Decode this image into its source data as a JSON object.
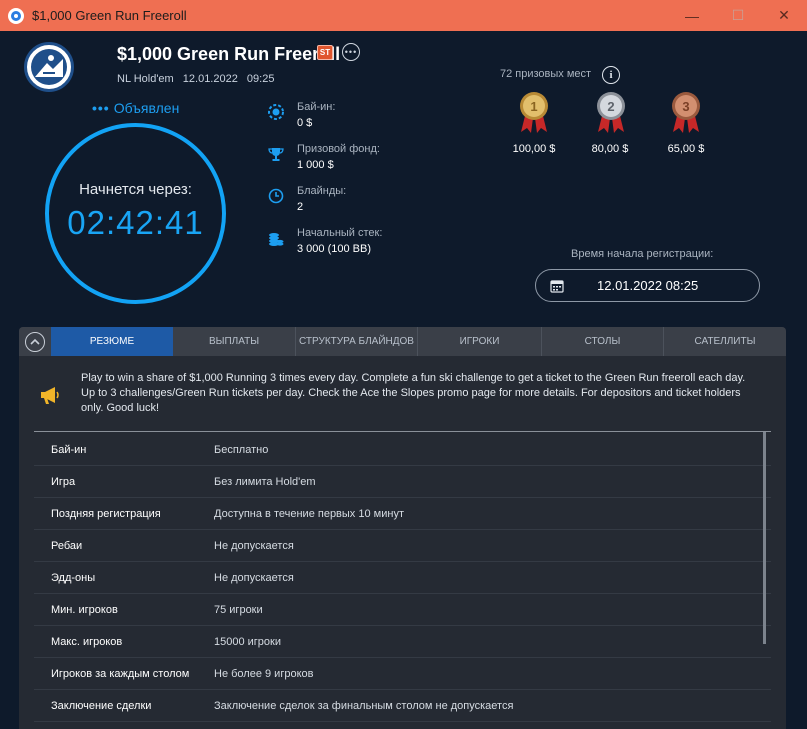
{
  "window": {
    "title": "$1,000 Green Run Freeroll",
    "min": "—",
    "max": "☐",
    "close": "✕"
  },
  "header": {
    "name": "$1,000 Green Run Freeroll",
    "badge": "ST",
    "more": "•••",
    "game": "NL Hold'em",
    "date": "12.01.2022",
    "time": "09:25"
  },
  "status": {
    "dots": "•••",
    "text": "Объявлен"
  },
  "countdown": {
    "label": "Начнется через:",
    "time": "02:42:41"
  },
  "info": [
    {
      "key": "Бай-ин:",
      "value": "0 $",
      "icon": "chip-icon"
    },
    {
      "key": "Призовой фонд:",
      "value": "1 000 $",
      "icon": "trophy-icon"
    },
    {
      "key": "Блайнды:",
      "value": "2",
      "icon": "clock-icon"
    },
    {
      "key": "Начальный стек:",
      "value": "3 000 (100 BB)",
      "icon": "chips-stack-icon"
    }
  ],
  "prizes": {
    "places": "72 призовых мест",
    "items": [
      {
        "place": "1",
        "value": "100,00 $",
        "color": "#c9a24a"
      },
      {
        "place": "2",
        "value": "80,00 $",
        "color": "#b9bec6"
      },
      {
        "place": "3",
        "value": "65,00 $",
        "color": "#c07a5a"
      }
    ]
  },
  "registration": {
    "label": "Время начала регистрации:",
    "value": "12.01.2022 08:25"
  },
  "tabs": [
    "РЕЗЮМЕ",
    "ВЫПЛАТЫ",
    "СТРУКТУРА БЛАЙНДОВ",
    "ИГРОКИ",
    "СТОЛЫ",
    "САТЕЛЛИТЫ"
  ],
  "promo": "Play to win a share of $1,000 Running 3 times every day. Complete a fun ski challenge to get a ticket to the Green Run freeroll each day. Up to 3 challenges/Green Run tickets per day. Check the Ace the Slopes promo page for more details. For depositors and ticket holders only. Good luck!",
  "details": [
    {
      "k": "Бай-ин",
      "v": "Бесплатно"
    },
    {
      "k": "Игра",
      "v": "Без лимита Hold'em"
    },
    {
      "k": "Поздняя регистрация",
      "v": "Доступна в течение первых 10 минут"
    },
    {
      "k": "Ребаи",
      "v": "Не допускается"
    },
    {
      "k": "Эдд-оны",
      "v": "Не допускается"
    },
    {
      "k": "Мин. игроков",
      "v": "75 игроки"
    },
    {
      "k": "Макс. игроков",
      "v": "15000 игроки"
    },
    {
      "k": "Игроков за каждым столом",
      "v": "Не более 9 игроков"
    },
    {
      "k": "Заключение сделки",
      "v": "Заключение сделок за финальным столом не допускается"
    }
  ],
  "colors": {
    "accent": "#12a3f5",
    "titlebar": "#ef6f52",
    "background": "#0e1a2b",
    "activeTab": "#1e5aa6"
  }
}
